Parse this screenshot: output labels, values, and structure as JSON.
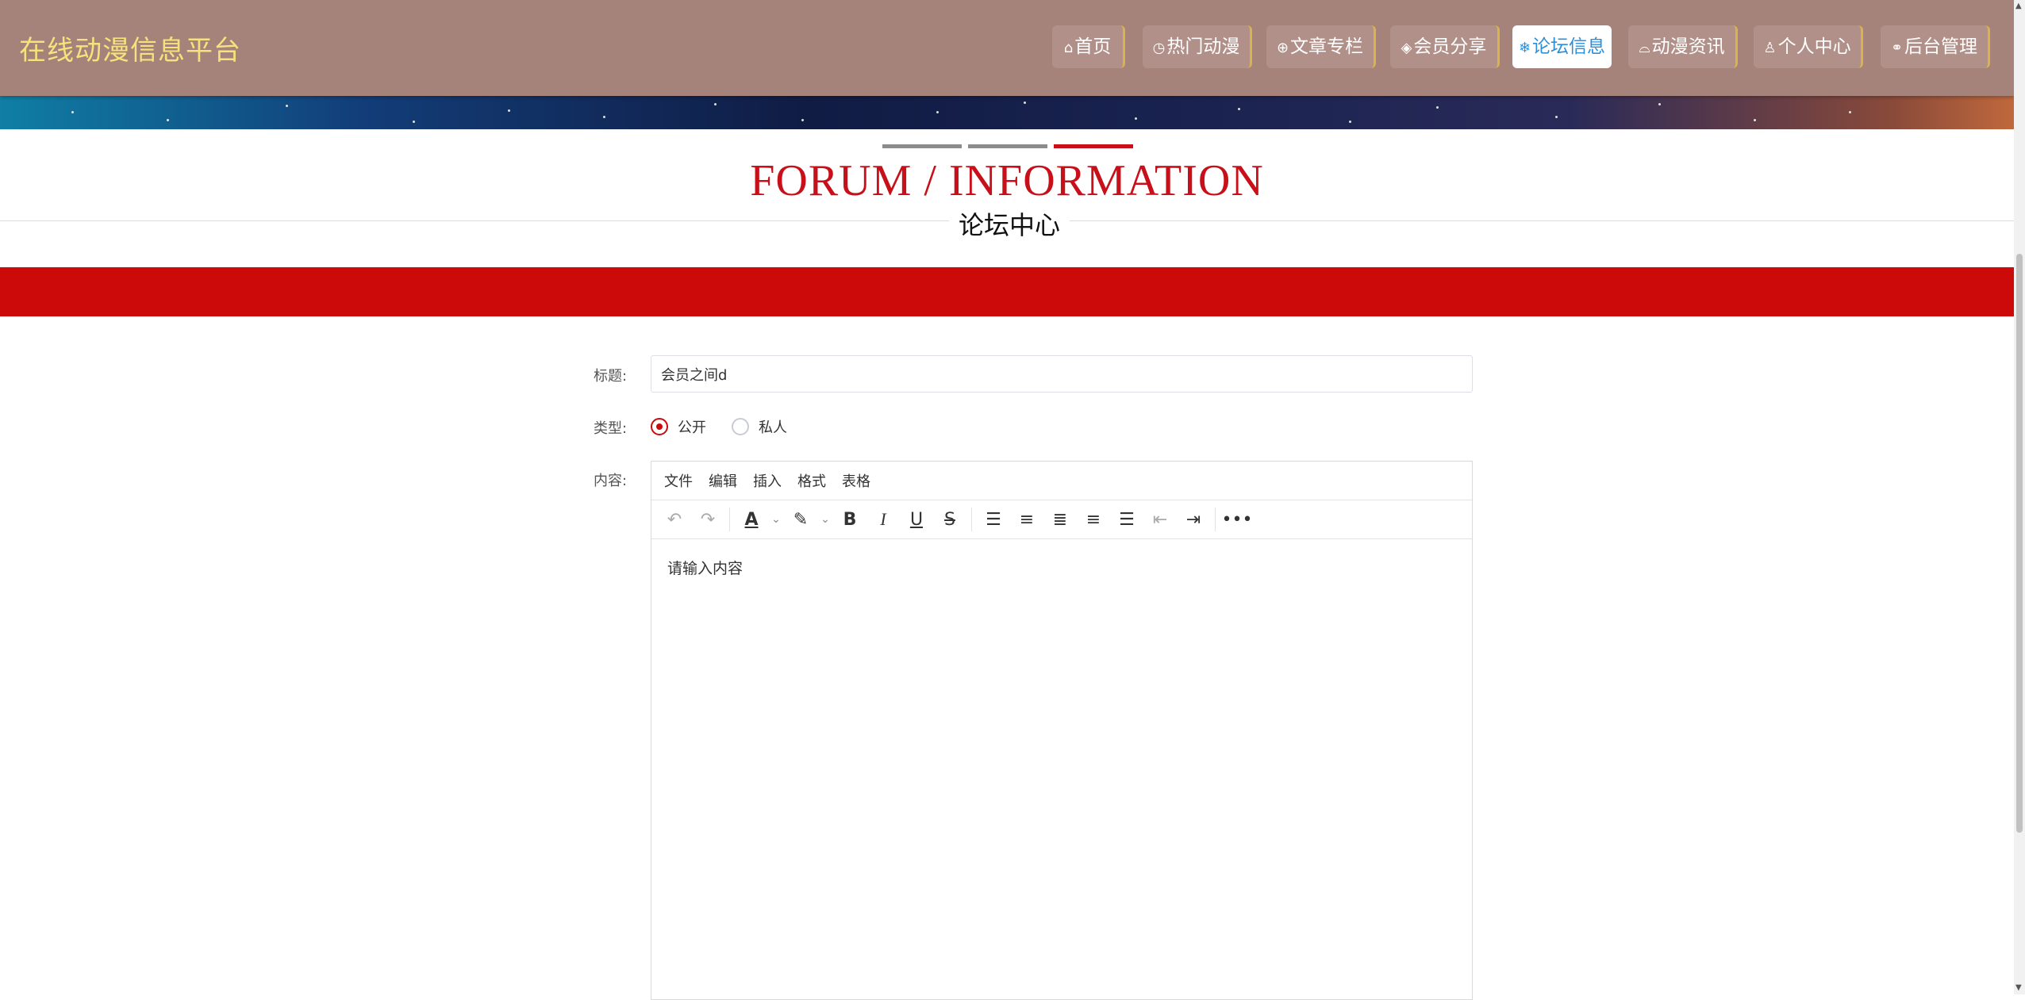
{
  "brand": "在线动漫信息平台",
  "nav": [
    {
      "icon": "⌂",
      "label": "首页",
      "active": false
    },
    {
      "icon": "◷",
      "label": "热门动漫",
      "active": false
    },
    {
      "icon": "⊕",
      "label": "文章专栏",
      "active": false
    },
    {
      "icon": "◈",
      "label": "会员分享",
      "active": false
    },
    {
      "icon": "❄",
      "label": "论坛信息",
      "active": true
    },
    {
      "icon": "⌓",
      "label": "动漫资讯",
      "active": false
    },
    {
      "icon": "♙",
      "label": "个人中心",
      "active": false
    },
    {
      "icon": "⚭",
      "label": "后台管理",
      "active": false
    }
  ],
  "section": {
    "title_en": "FORUM / INFORMATION",
    "title_cn": "论坛中心"
  },
  "form": {
    "title_label": "标题:",
    "title_value": "会员之间d",
    "type_label": "类型:",
    "type_options": [
      {
        "label": "公开",
        "checked": true
      },
      {
        "label": "私人",
        "checked": false
      }
    ],
    "content_label": "内容:",
    "editor_menu": [
      "文件",
      "编辑",
      "插入",
      "格式",
      "表格"
    ],
    "editor_placeholder": "请输入内容"
  },
  "colors": {
    "navbar": "#a5827a",
    "brand": "#f6e27c",
    "active_nav": "#2d8fd8",
    "accent_red": "#cc0a0a"
  }
}
